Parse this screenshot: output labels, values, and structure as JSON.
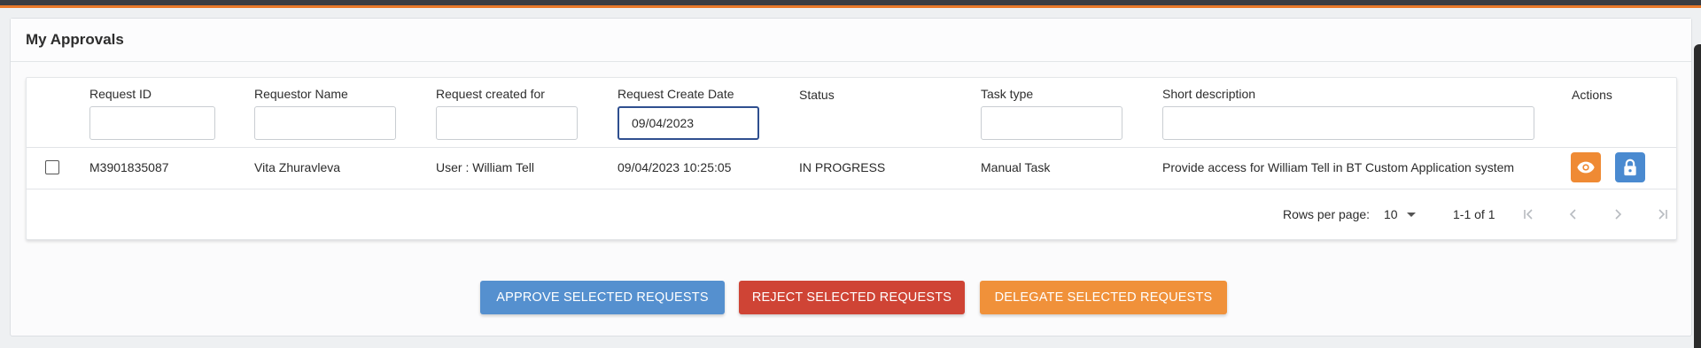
{
  "panel": {
    "title": "My Approvals"
  },
  "table": {
    "columns": [
      {
        "key": "request_id",
        "label": "Request ID",
        "filter_value": ""
      },
      {
        "key": "requestor_name",
        "label": "Requestor Name",
        "filter_value": ""
      },
      {
        "key": "created_for",
        "label": "Request created for",
        "filter_value": ""
      },
      {
        "key": "create_date",
        "label": "Request Create Date",
        "filter_value": "09/04/2023"
      },
      {
        "key": "status",
        "label": "Status"
      },
      {
        "key": "task_type",
        "label": "Task type",
        "filter_value": ""
      },
      {
        "key": "short_description",
        "label": "Short description",
        "filter_value": ""
      },
      {
        "key": "actions",
        "label": "Actions"
      }
    ],
    "rows": [
      {
        "request_id": "M3901835087",
        "requestor_name": "Vita Zhuravleva",
        "created_for": "User : William Tell",
        "create_date": "09/04/2023 10:25:05",
        "status": "IN PROGRESS",
        "task_type": "Manual Task",
        "short_description": "Provide access for William Tell in BT Custom Application system",
        "actions": [
          "eye-icon",
          "lock-icon"
        ]
      }
    ]
  },
  "pagination": {
    "rows_per_page_label": "Rows per page:",
    "rows_per_page_value": "10",
    "range": "1-1 of 1",
    "icons": [
      "first-page-icon",
      "previous-page-icon",
      "next-page-icon",
      "last-page-icon"
    ]
  },
  "buttons": {
    "approve": "APPROVE SELECTED REQUESTS",
    "reject": "REJECT SELECTED REQUESTS",
    "delegate": "DELEGATE SELECTED REQUESTS"
  },
  "colors": {
    "approve": "#5590cf",
    "reject": "#cf4435",
    "delegate": "#f0913a",
    "view_action": "#ef8a34",
    "lock_action": "#4a8ad0",
    "active_filter_border": "#2f4f8f",
    "top_accent": "#e8792a"
  }
}
